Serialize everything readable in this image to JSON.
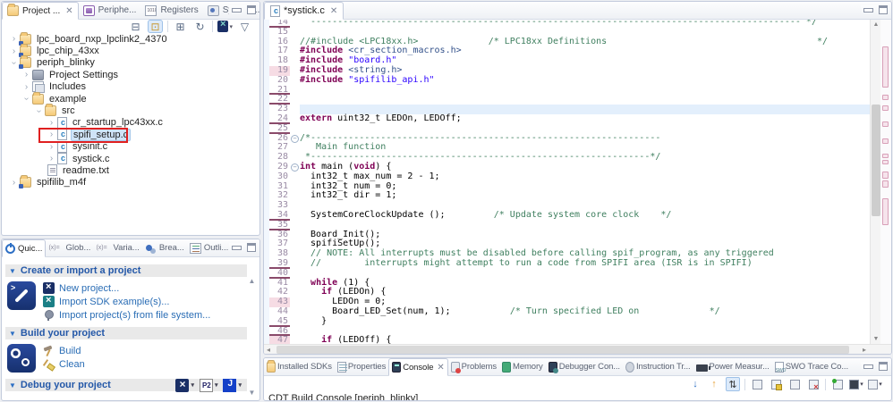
{
  "explorer": {
    "tabs": [
      {
        "label": "Project ...",
        "icon": "project-explorer",
        "active": true,
        "closable": true
      },
      {
        "label": "Periphe...",
        "icon": "peripherals"
      },
      {
        "label": "Registers",
        "icon": "registers"
      },
      {
        "label": "Symbol...",
        "icon": "symbols"
      }
    ],
    "toolbar": [
      {
        "name": "collapse-all",
        "glyph": "⊟"
      },
      {
        "name": "link-with-editor",
        "glyph": "⊡",
        "highlighted": true
      },
      {
        "name": "expand-all",
        "glyph": "⊞"
      },
      {
        "name": "refresh",
        "glyph": "↻"
      },
      {
        "name": "mcux-new",
        "glyph": "",
        "logo": true,
        "dropdown": true
      },
      {
        "name": "view-menu",
        "glyph": "▽"
      }
    ],
    "tree": [
      {
        "label": "lpc_board_nxp_lpclink2_4370",
        "indent": 8,
        "chevron": "collapsed",
        "icon": "project"
      },
      {
        "label": "lpc_chip_43xx",
        "indent": 8,
        "chevron": "collapsed",
        "icon": "project"
      },
      {
        "label": "periph_blinky",
        "indent": 8,
        "chevron": "expanded",
        "icon": "project"
      },
      {
        "label": "Project Settings",
        "indent": 22,
        "chevron": "collapsed",
        "icon": "settings"
      },
      {
        "label": "Includes",
        "indent": 22,
        "chevron": "collapsed",
        "icon": "includes"
      },
      {
        "label": "example",
        "indent": 22,
        "chevron": "expanded",
        "icon": "folder"
      },
      {
        "label": "src",
        "indent": 36,
        "chevron": "expanded",
        "icon": "folder-open"
      },
      {
        "label": "cr_startup_lpc43xx.c",
        "indent": 50,
        "chevron": "collapsed",
        "icon": "c-file"
      },
      {
        "label": "spifi_setup.c",
        "indent": 50,
        "chevron": "collapsed",
        "icon": "c-file",
        "selected": true,
        "annotated": true
      },
      {
        "label": "sysinit.c",
        "indent": 50,
        "chevron": "collapsed",
        "icon": "c-file"
      },
      {
        "label": "systick.c",
        "indent": 50,
        "chevron": "collapsed",
        "icon": "c-file"
      },
      {
        "label": "readme.txt",
        "indent": 50,
        "chevron": "none",
        "icon": "text-file"
      },
      {
        "label": "spifilib_m4f",
        "indent": 8,
        "chevron": "collapsed",
        "icon": "project"
      }
    ]
  },
  "quickstart": {
    "tabs": [
      {
        "label": "Quic...",
        "icon": "quickstart",
        "active": true
      },
      {
        "label": "Glob...",
        "icon": "globals"
      },
      {
        "label": "Varia...",
        "icon": "variables"
      },
      {
        "label": "Brea...",
        "icon": "breakpoints"
      },
      {
        "label": "Outli...",
        "icon": "outline"
      }
    ],
    "sections": [
      {
        "title": "Create or import a project",
        "big_icon": "new-project-wizard",
        "links": [
          {
            "icon": "mcux-x-blue",
            "label": "New project..."
          },
          {
            "icon": "mcux-x-teal",
            "label": "Import SDK example(s)..."
          },
          {
            "icon": "import-plug",
            "label": "Import project(s) from file system..."
          }
        ]
      },
      {
        "title": "Build your project",
        "big_icon": "build-gears",
        "links": [
          {
            "icon": "hammer",
            "label": "Build"
          },
          {
            "icon": "broom",
            "label": "Clean"
          }
        ]
      },
      {
        "title": "Debug your project",
        "big_icon": null,
        "links": [],
        "debug_probes": [
          "mcux",
          "pemicro",
          "jlink"
        ]
      }
    ]
  },
  "editor": {
    "tab": {
      "label": "*systick.c",
      "icon": "c-file",
      "closable": true
    },
    "lines": [
      {
        "n": 14,
        "diff": true,
        "segs": [
          [
            "c",
            "  ------------------------------------------------------------------------------------------- */"
          ]
        ]
      },
      {
        "n": 15,
        "segs": []
      },
      {
        "n": 16,
        "segs": [
          [
            "c",
            "//#include <LPC18xx.h>             /* LPC18xx Definitions                                       */"
          ]
        ]
      },
      {
        "n": 17,
        "segs": [
          [
            "d",
            "#include"
          ],
          [
            "p",
            " "
          ],
          [
            "i",
            "<cr_section_macros.h>"
          ]
        ]
      },
      {
        "n": 18,
        "segs": [
          [
            "d",
            "#include"
          ],
          [
            "p",
            " "
          ],
          [
            "s",
            "\"board.h\""
          ]
        ]
      },
      {
        "n": 19,
        "pink": true,
        "segs": [
          [
            "d",
            "#include"
          ],
          [
            "p",
            " "
          ],
          [
            "i",
            "<string.h>"
          ]
        ]
      },
      {
        "n": 20,
        "segs": [
          [
            "d",
            "#include"
          ],
          [
            "p",
            " "
          ],
          [
            "s",
            "\"spifilib_api.h\""
          ]
        ]
      },
      {
        "n": 21,
        "diff": true,
        "segs": []
      },
      {
        "n": 22,
        "diff": true,
        "segs": []
      },
      {
        "n": 23,
        "hl": true,
        "segs": []
      },
      {
        "n": 24,
        "diff": true,
        "segs": [
          [
            "k",
            "extern"
          ],
          [
            "p",
            " uint32_t LEDOn, LEDOff;"
          ]
        ]
      },
      {
        "n": 25,
        "diff": true,
        "segs": []
      },
      {
        "n": 26,
        "fold": true,
        "segs": [
          [
            "c",
            "/*-----------------------------------------------------------------"
          ]
        ]
      },
      {
        "n": 27,
        "segs": [
          [
            "c",
            "   Main function"
          ]
        ]
      },
      {
        "n": 28,
        "segs": [
          [
            "c",
            " *---------------------------------------------------------------*/"
          ]
        ]
      },
      {
        "n": 29,
        "fold": true,
        "segs": [
          [
            "k",
            "int"
          ],
          [
            "p",
            " main ("
          ],
          [
            "k",
            "void"
          ],
          [
            "p",
            ") {"
          ]
        ]
      },
      {
        "n": 30,
        "segs": [
          [
            "p",
            "  int32_t max_num = 2 - 1;"
          ]
        ]
      },
      {
        "n": 31,
        "segs": [
          [
            "p",
            "  int32_t num = 0;"
          ]
        ]
      },
      {
        "n": 32,
        "segs": [
          [
            "p",
            "  int32_t dir = 1;"
          ]
        ]
      },
      {
        "n": 33,
        "segs": []
      },
      {
        "n": 34,
        "diff": true,
        "segs": [
          [
            "p",
            "  SystemCoreClockUpdate ();         "
          ],
          [
            "c",
            "/* Update system core clock    */"
          ]
        ]
      },
      {
        "n": 35,
        "diff": true,
        "segs": []
      },
      {
        "n": 36,
        "segs": [
          [
            "p",
            "  Board_Init();"
          ]
        ]
      },
      {
        "n": 37,
        "segs": [
          [
            "p",
            "  spifiSetUp();"
          ]
        ]
      },
      {
        "n": 38,
        "segs": [
          [
            "c",
            "  // NOTE: All interrupts must be disabled before calling spif_program, as any triggered"
          ]
        ]
      },
      {
        "n": 39,
        "diff": true,
        "segs": [
          [
            "c",
            "  //        interrupts might attempt to run a code from SPIFI area (ISR is in SPIFI)"
          ]
        ]
      },
      {
        "n": 40,
        "diff": true,
        "segs": []
      },
      {
        "n": 41,
        "segs": [
          [
            "p",
            "  "
          ],
          [
            "k",
            "while"
          ],
          [
            "p",
            " (1) {"
          ]
        ]
      },
      {
        "n": 42,
        "segs": [
          [
            "p",
            "    "
          ],
          [
            "k",
            "if"
          ],
          [
            "p",
            " (LEDOn) {"
          ]
        ]
      },
      {
        "n": 43,
        "pink": true,
        "segs": [
          [
            "p",
            "      LEDOn = 0;"
          ]
        ]
      },
      {
        "n": 44,
        "segs": [
          [
            "p",
            "      Board_LED_Set(num, 1);           "
          ],
          [
            "c",
            "/* Turn specified LED on             */"
          ]
        ]
      },
      {
        "n": 45,
        "diff": true,
        "segs": [
          [
            "p",
            "    }"
          ]
        ]
      },
      {
        "n": 46,
        "diff": true,
        "segs": []
      },
      {
        "n": 47,
        "pink": true,
        "segs": [
          [
            "p",
            "    "
          ],
          [
            "k",
            "if"
          ],
          [
            "p",
            " (LEDOff) {"
          ]
        ]
      }
    ]
  },
  "console": {
    "tabs": [
      {
        "label": "Installed SDKs",
        "icon": "sdk"
      },
      {
        "label": "Properties",
        "icon": "properties"
      },
      {
        "label": "Console",
        "icon": "console",
        "active": true,
        "closable": true
      },
      {
        "label": "Problems",
        "icon": "problems"
      },
      {
        "label": "Memory",
        "icon": "memory"
      },
      {
        "label": "Debugger Con...",
        "icon": "debugger-console"
      },
      {
        "label": "Instruction Tr...",
        "icon": "instruction-trace"
      },
      {
        "label": "Power Measur...",
        "icon": "power-measurement"
      },
      {
        "label": "SWO Trace Co...",
        "icon": "swo-trace"
      }
    ],
    "toolbar": [
      {
        "name": "scroll-down",
        "kind": "arr-dn",
        "glyph": "↓"
      },
      {
        "name": "scroll-up",
        "kind": "arr-up",
        "glyph": "↑"
      },
      {
        "name": "scroll-lock",
        "kind": "hl",
        "glyph": "⇅"
      },
      {
        "name": "sep"
      },
      {
        "name": "pin-console",
        "kind": "gbox"
      },
      {
        "name": "show-stdout-lock",
        "kind": "gbox lock"
      },
      {
        "name": "word-wrap",
        "kind": "gbox"
      },
      {
        "name": "clear-console",
        "kind": "gbox redx"
      },
      {
        "name": "sep"
      },
      {
        "name": "open-console",
        "kind": "gbox grn"
      },
      {
        "name": "display-console",
        "kind": "gbox dark",
        "dropdown": true
      },
      {
        "name": "new-console",
        "kind": "gbox",
        "dropdown": true
      }
    ],
    "status": "CDT Build Console [periph_blinky]"
  }
}
